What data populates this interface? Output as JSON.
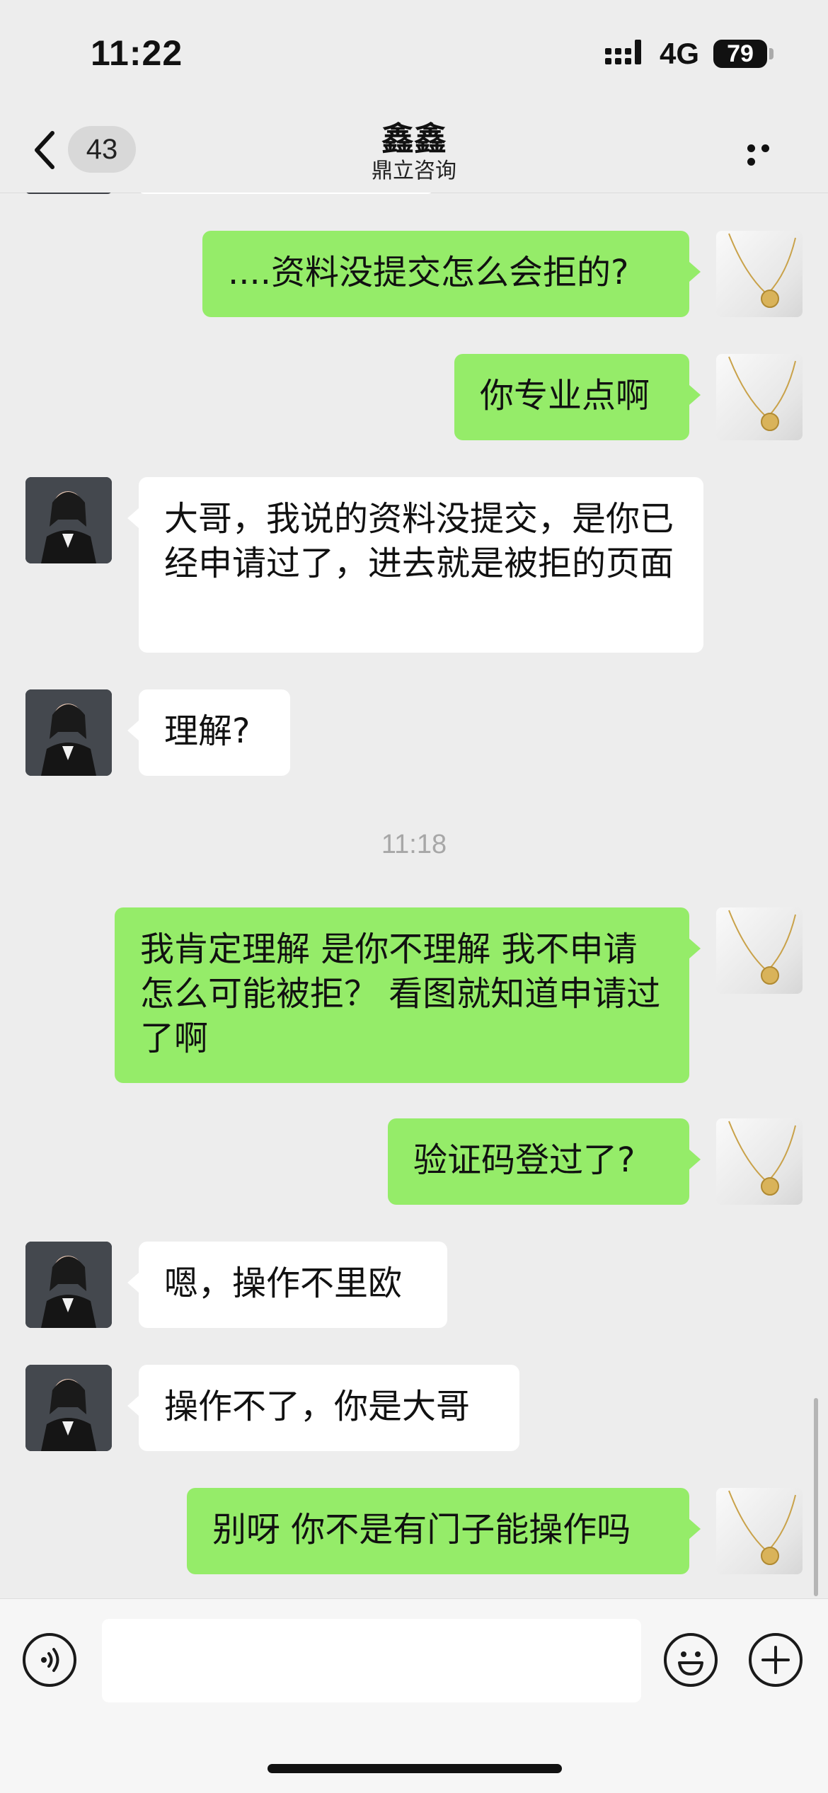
{
  "status_bar": {
    "time": "11:22",
    "network": "4G",
    "battery": "79"
  },
  "nav": {
    "unread_count": "43",
    "contact_name": "鑫鑫",
    "contact_company": "鼎立咨询"
  },
  "colors": {
    "sent_bubble": "#95ec69",
    "received_bubble": "#ffffff",
    "background": "#ededed"
  },
  "messages": [
    {
      "from": "me",
      "text": "....资料没提交怎么会拒的?"
    },
    {
      "from": "me",
      "text": "你专业点啊"
    },
    {
      "from": "them",
      "text": "大哥，我说的资料没提交，是你已经申请过了，进去就是被拒的页面"
    },
    {
      "from": "them",
      "text": "理解?"
    },
    {
      "type": "timestamp",
      "text": "11:18"
    },
    {
      "from": "me",
      "text": "我肯定理解 是你不理解 我不申请怎么可能被拒？ 看图就知道申请过了啊"
    },
    {
      "from": "me",
      "text": "验证码登过了?"
    },
    {
      "from": "them",
      "text": "嗯，操作不里欧"
    },
    {
      "from": "them",
      "text": "操作不了，你是大哥"
    },
    {
      "from": "me",
      "text": "别呀 你不是有门子能操作吗"
    }
  ],
  "icons": {
    "back": "chevron-left-icon",
    "more": "more-dots-icon",
    "voice": "voice-icon",
    "emoji": "emoji-icon",
    "plus": "plus-icon"
  }
}
